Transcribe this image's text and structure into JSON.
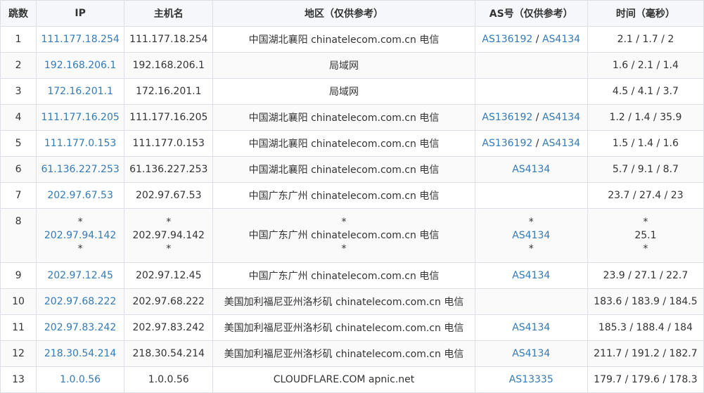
{
  "header": {
    "hop": "跳数",
    "ip": "IP",
    "host": "主机名",
    "region": "地区（仅供参考）",
    "as": "AS号（仅供参考）",
    "time": "时间（毫秒）"
  },
  "as_separator": " / ",
  "rows": [
    {
      "hop": "1",
      "ip": "111.177.18.254",
      "host": "111.177.18.254",
      "region": "中国湖北襄阳 chinatelecom.com.cn 电信",
      "as": [
        "AS136192",
        "AS4134"
      ],
      "time": "2.1 / 1.7 / 2"
    },
    {
      "hop": "2",
      "ip": "192.168.206.1",
      "host": "192.168.206.1",
      "region": "局域网",
      "as": [],
      "time": "1.6 / 2.1 / 1.4"
    },
    {
      "hop": "3",
      "ip": "172.16.201.1",
      "host": "172.16.201.1",
      "region": "局域网",
      "as": [],
      "time": "4.5 / 4.1 / 3.7"
    },
    {
      "hop": "4",
      "ip": "111.177.16.205",
      "host": "111.177.16.205",
      "region": "中国湖北襄阳 chinatelecom.com.cn 电信",
      "as": [
        "AS136192",
        "AS4134"
      ],
      "time": "1.2 / 1.4 / 35.9"
    },
    {
      "hop": "5",
      "ip": "111.177.0.153",
      "host": "111.177.0.153",
      "region": "中国湖北襄阳 chinatelecom.com.cn 电信",
      "as": [
        "AS136192",
        "AS4134"
      ],
      "time": "1.5 / 1.4 / 1.6"
    },
    {
      "hop": "6",
      "ip": "61.136.227.253",
      "host": "61.136.227.253",
      "region": "中国湖北襄阳 chinatelecom.com.cn 电信",
      "as": [
        "AS4134"
      ],
      "time": "5.7 / 9.1 / 8.7"
    },
    {
      "hop": "7",
      "ip": "202.97.67.53",
      "host": "202.97.67.53",
      "region": "中国广东广州 chinatelecom.com.cn 电信",
      "as": [],
      "time": "23.7 / 27.4 / 23"
    },
    {
      "hop": "8",
      "multi": true,
      "ip_lines": [
        "*",
        "202.97.94.142",
        "*"
      ],
      "host_lines": [
        "*",
        "202.97.94.142",
        "*"
      ],
      "region_lines": [
        "*",
        "中国广东广州 chinatelecom.com.cn 电信",
        "*"
      ],
      "as_lines": [
        "*",
        "AS4134",
        "*"
      ],
      "time_lines": [
        "*",
        "25.1",
        "*"
      ]
    },
    {
      "hop": "9",
      "ip": "202.97.12.45",
      "host": "202.97.12.45",
      "region": "中国广东广州 chinatelecom.com.cn 电信",
      "as": [
        "AS4134"
      ],
      "time": "23.9 / 27.1 / 22.7"
    },
    {
      "hop": "10",
      "ip": "202.97.68.222",
      "host": "202.97.68.222",
      "region": "美国加利福尼亚州洛杉矶 chinatelecom.com.cn 电信",
      "as": [],
      "time": "183.6 / 183.9 / 184.5"
    },
    {
      "hop": "11",
      "ip": "202.97.83.242",
      "host": "202.97.83.242",
      "region": "美国加利福尼亚州洛杉矶 chinatelecom.com.cn 电信",
      "as": [
        "AS4134"
      ],
      "time": "185.3 / 188.4 / 184"
    },
    {
      "hop": "12",
      "ip": "218.30.54.214",
      "host": "218.30.54.214",
      "region": "美国加利福尼亚州洛杉矶 chinatelecom.com.cn 电信",
      "as": [
        "AS4134"
      ],
      "time": "211.7 / 191.2 / 182.7"
    },
    {
      "hop": "13",
      "ip": "1.0.0.56",
      "host": "1.0.0.56",
      "region": "CLOUDFLARE.COM apnic.net",
      "as": [
        "AS13335"
      ],
      "time": "179.7 / 179.6 / 178.3"
    }
  ],
  "colors": {
    "link": "#337ab7",
    "header_bg": "#f5f7fa",
    "border": "#dcdfe6",
    "stripe": "#fafafa"
  }
}
